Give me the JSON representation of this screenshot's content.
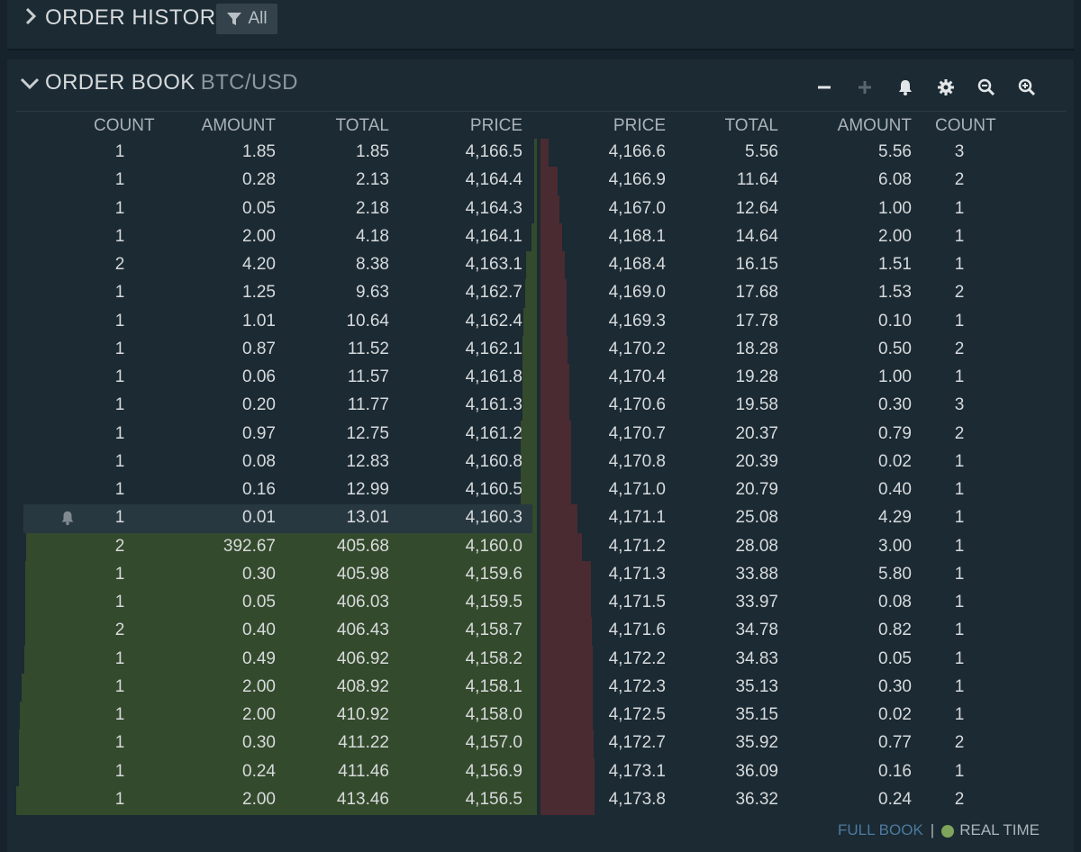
{
  "order_history": {
    "title": "ORDER HISTORY",
    "filter_label": "All"
  },
  "order_book": {
    "title": "ORDER BOOK",
    "pair": "BTC/USD",
    "headers": {
      "bid_count": "COUNT",
      "bid_amount": "AMOUNT",
      "bid_total": "TOTAL",
      "bid_price": "PRICE",
      "ask_price": "PRICE",
      "ask_total": "TOTAL",
      "ask_amount": "AMOUNT",
      "ask_count": "COUNT"
    },
    "toolbar": [
      "minus-icon",
      "plus-icon",
      "bell-icon",
      "gear-icon",
      "zoom-out-icon",
      "zoom-in-icon"
    ],
    "highlighted_row": 13,
    "colors": {
      "bid_bar": "#344a2c",
      "ask_bar": "#4a2b31",
      "accent": "#7fa55a"
    },
    "rows": [
      {
        "bc": "1",
        "ba": "1.85",
        "bt": "1.85",
        "bp": "4,166.5",
        "ap": "4,166.6",
        "at": "5.56",
        "aa": "5.56",
        "ac": "3"
      },
      {
        "bc": "1",
        "ba": "0.28",
        "bt": "2.13",
        "bp": "4,164.4",
        "ap": "4,166.9",
        "at": "11.64",
        "aa": "6.08",
        "ac": "2"
      },
      {
        "bc": "1",
        "ba": "0.05",
        "bt": "2.18",
        "bp": "4,164.3",
        "ap": "4,167.0",
        "at": "12.64",
        "aa": "1.00",
        "ac": "1"
      },
      {
        "bc": "1",
        "ba": "2.00",
        "bt": "4.18",
        "bp": "4,164.1",
        "ap": "4,168.1",
        "at": "14.64",
        "aa": "2.00",
        "ac": "1"
      },
      {
        "bc": "2",
        "ba": "4.20",
        "bt": "8.38",
        "bp": "4,163.1",
        "ap": "4,168.4",
        "at": "16.15",
        "aa": "1.51",
        "ac": "1"
      },
      {
        "bc": "1",
        "ba": "1.25",
        "bt": "9.63",
        "bp": "4,162.7",
        "ap": "4,169.0",
        "at": "17.68",
        "aa": "1.53",
        "ac": "2"
      },
      {
        "bc": "1",
        "ba": "1.01",
        "bt": "10.64",
        "bp": "4,162.4",
        "ap": "4,169.3",
        "at": "17.78",
        "aa": "0.10",
        "ac": "1"
      },
      {
        "bc": "1",
        "ba": "0.87",
        "bt": "11.52",
        "bp": "4,162.1",
        "ap": "4,170.2",
        "at": "18.28",
        "aa": "0.50",
        "ac": "2"
      },
      {
        "bc": "1",
        "ba": "0.06",
        "bt": "11.57",
        "bp": "4,161.8",
        "ap": "4,170.4",
        "at": "19.28",
        "aa": "1.00",
        "ac": "1"
      },
      {
        "bc": "1",
        "ba": "0.20",
        "bt": "11.77",
        "bp": "4,161.3",
        "ap": "4,170.6",
        "at": "19.58",
        "aa": "0.30",
        "ac": "3"
      },
      {
        "bc": "1",
        "ba": "0.97",
        "bt": "12.75",
        "bp": "4,161.2",
        "ap": "4,170.7",
        "at": "20.37",
        "aa": "0.79",
        "ac": "2"
      },
      {
        "bc": "1",
        "ba": "0.08",
        "bt": "12.83",
        "bp": "4,160.8",
        "ap": "4,170.8",
        "at": "20.39",
        "aa": "0.02",
        "ac": "1"
      },
      {
        "bc": "1",
        "ba": "0.16",
        "bt": "12.99",
        "bp": "4,160.5",
        "ap": "4,171.0",
        "at": "20.79",
        "aa": "0.40",
        "ac": "1"
      },
      {
        "bc": "1",
        "ba": "0.01",
        "bt": "13.01",
        "bp": "4,160.3",
        "ap": "4,171.1",
        "at": "25.08",
        "aa": "4.29",
        "ac": "1"
      },
      {
        "bc": "2",
        "ba": "392.67",
        "bt": "405.68",
        "bp": "4,160.0",
        "ap": "4,171.2",
        "at": "28.08",
        "aa": "3.00",
        "ac": "1"
      },
      {
        "bc": "1",
        "ba": "0.30",
        "bt": "405.98",
        "bp": "4,159.6",
        "ap": "4,171.3",
        "at": "33.88",
        "aa": "5.80",
        "ac": "1"
      },
      {
        "bc": "1",
        "ba": "0.05",
        "bt": "406.03",
        "bp": "4,159.5",
        "ap": "4,171.5",
        "at": "33.97",
        "aa": "0.08",
        "ac": "1"
      },
      {
        "bc": "2",
        "ba": "0.40",
        "bt": "406.43",
        "bp": "4,158.7",
        "ap": "4,171.6",
        "at": "34.78",
        "aa": "0.82",
        "ac": "1"
      },
      {
        "bc": "1",
        "ba": "0.49",
        "bt": "406.92",
        "bp": "4,158.2",
        "ap": "4,172.2",
        "at": "34.83",
        "aa": "0.05",
        "ac": "1"
      },
      {
        "bc": "1",
        "ba": "2.00",
        "bt": "408.92",
        "bp": "4,158.1",
        "ap": "4,172.3",
        "at": "35.13",
        "aa": "0.30",
        "ac": "1"
      },
      {
        "bc": "1",
        "ba": "2.00",
        "bt": "410.92",
        "bp": "4,158.0",
        "ap": "4,172.5",
        "at": "35.15",
        "aa": "0.02",
        "ac": "1"
      },
      {
        "bc": "1",
        "ba": "0.30",
        "bt": "411.22",
        "bp": "4,157.0",
        "ap": "4,172.7",
        "at": "35.92",
        "aa": "0.77",
        "ac": "2"
      },
      {
        "bc": "1",
        "ba": "0.24",
        "bt": "411.46",
        "bp": "4,156.9",
        "ap": "4,173.1",
        "at": "36.09",
        "aa": "0.16",
        "ac": "1"
      },
      {
        "bc": "1",
        "ba": "2.00",
        "bt": "413.46",
        "bp": "4,156.5",
        "ap": "4,173.8",
        "at": "36.32",
        "aa": "0.24",
        "ac": "2"
      }
    ],
    "footer": {
      "full_book": "FULL BOOK",
      "real_time": "REAL TIME"
    }
  }
}
